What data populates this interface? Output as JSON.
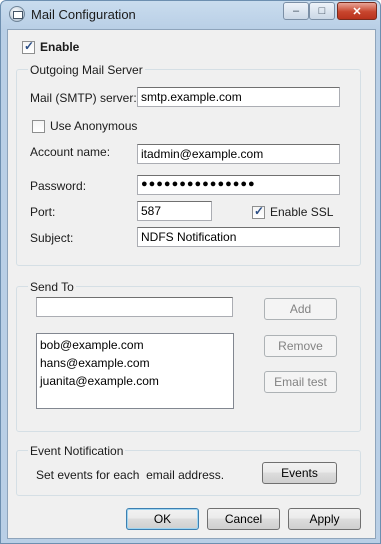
{
  "window": {
    "title": "Mail Configuration",
    "icon": "mail-config-icon",
    "controls": {
      "minimize": "–",
      "maximize": "□",
      "close": "✕"
    }
  },
  "enable": {
    "label": "Enable",
    "checked": true
  },
  "outgoing": {
    "group_title": "Outgoing Mail Server",
    "smtp_label": "Mail (SMTP) server:",
    "smtp_value": "smtp.example.com",
    "anonymous_label": "Use Anonymous",
    "anonymous_checked": false,
    "account_label": "Account name:",
    "account_value": "itadmin@example.com",
    "password_label": "Password:",
    "password_value": "●●●●●●●●●●●●●●●",
    "port_label": "Port:",
    "port_value": "587",
    "ssl_label": "Enable SSL",
    "ssl_checked": true,
    "subject_label": "Subject:",
    "subject_value": "NDFS Notification"
  },
  "send_to": {
    "group_title": "Send To",
    "new_address_value": "",
    "add_label": "Add",
    "remove_label": "Remove",
    "email_test_label": "Email test",
    "recipients": [
      "bob@example.com",
      "hans@example.com",
      "juanita@example.com"
    ]
  },
  "event_notification": {
    "group_title": "Event Notification",
    "description": "Set events for each  email address.",
    "events_label": "Events"
  },
  "footer": {
    "ok_label": "OK",
    "cancel_label": "Cancel",
    "apply_label": "Apply"
  },
  "check_mark": "✓"
}
